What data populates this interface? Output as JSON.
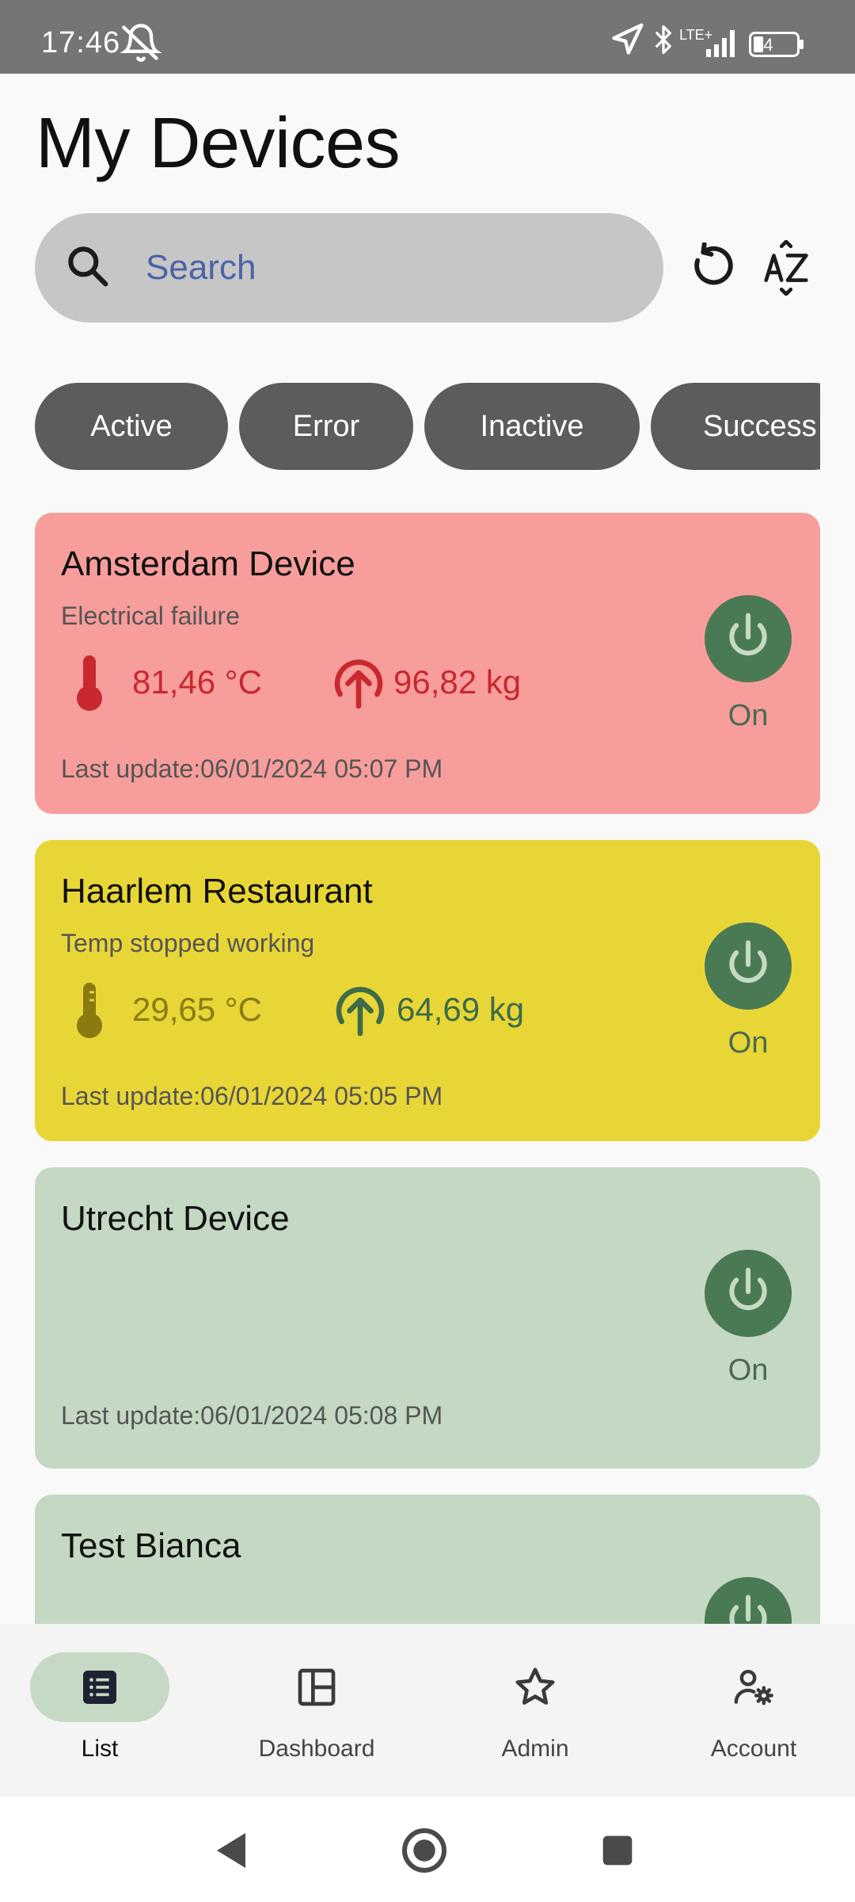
{
  "status_bar": {
    "time": "17:46",
    "network": "LTE+",
    "battery": "24",
    "icons": [
      "alarm-off-icon",
      "location-icon",
      "bluetooth-icon",
      "signal-icon",
      "battery-icon"
    ]
  },
  "header": {
    "title": "My Devices"
  },
  "search": {
    "placeholder": "Search",
    "value": ""
  },
  "toolbar": {
    "icons": [
      "refresh-icon",
      "sort-az-icon"
    ]
  },
  "filters": {
    "chips": [
      {
        "label": "Active"
      },
      {
        "label": "Error"
      },
      {
        "label": "Inactive"
      },
      {
        "label": "Success"
      }
    ]
  },
  "devices": [
    {
      "name": "Amsterdam Device",
      "message": "Electrical failure",
      "temperature": "81,46 °C",
      "weight": "96,82 kg",
      "last_update": "Last update:06/01/2024 05:07 PM",
      "power_label": "On",
      "background": "#f79d9b",
      "accent": "#c8282e"
    },
    {
      "name": "Haarlem Restaurant",
      "message": "Temp stopped working",
      "temperature": "29,65 °C",
      "weight": "64,69 kg",
      "last_update": "Last update:06/01/2024 05:05 PM",
      "power_label": "On",
      "background": "#e8d637",
      "accent_temperature": "#8a7a10",
      "accent_weight": "#3e6b48"
    },
    {
      "name": "Utrecht Device",
      "last_update": "Last update:06/01/2024 05:08 PM",
      "power_label": "On",
      "background": "#c4d8c3"
    },
    {
      "name": "Test Bianca",
      "background": "#c4d8c3"
    }
  ],
  "bottom_nav": {
    "items": [
      {
        "label": "List",
        "active": true
      },
      {
        "label": "Dashboard",
        "active": false
      },
      {
        "label": "Admin",
        "active": false
      },
      {
        "label": "Account",
        "active": false
      }
    ]
  },
  "colors": {
    "power_button": "#4a7a54",
    "chip": "#5c5c5c",
    "nav_active_pill": "#c6d9c4"
  }
}
